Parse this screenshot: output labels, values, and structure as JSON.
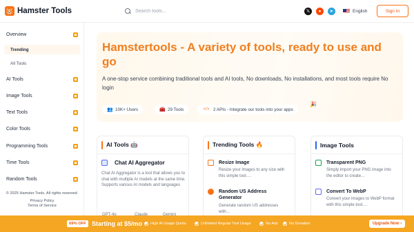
{
  "header": {
    "logo_glyph": "🐹",
    "logo_text": "Hamster Tools",
    "search_placeholder": "Search tools...",
    "language": "English",
    "signin_label": "Sign In",
    "social": [
      {
        "icon": "x-twitter-icon",
        "glyph": "𝕏",
        "color": "#111111"
      },
      {
        "icon": "reddit-icon",
        "glyph": "●",
        "color": "#ff4500"
      },
      {
        "icon": "telegram-icon",
        "glyph": "➤",
        "color": "#2aa3df"
      }
    ]
  },
  "sidebar": {
    "items": [
      {
        "label": "Overview"
      },
      {
        "label": "Trending"
      },
      {
        "label": "All Tools"
      },
      {
        "label": "AI Tools"
      },
      {
        "label": "Image Tools"
      },
      {
        "label": "Text Tools"
      },
      {
        "label": "Color Tools"
      },
      {
        "label": "Programming Tools"
      },
      {
        "label": "Time Tools"
      },
      {
        "label": "Random Tools"
      }
    ],
    "copyright": "© 2025 Hamster Tools. All rights reserved.",
    "privacy": "Privacy Policy",
    "terms": "Terms of Service"
  },
  "hero": {
    "title": "Hamstertools - A variety of tools, ready to use and go",
    "description": "A one-stop service combining traditional tools and AI tools, No downloads, No installations, and most tools require No login",
    "stats": [
      {
        "icon": "users-icon",
        "glyph": "👥",
        "label": "10K+ Users"
      },
      {
        "icon": "tools-icon",
        "glyph": "🧰",
        "label": "29 Tools"
      },
      {
        "icon": "code-icon",
        "glyph": "</>",
        "label": "2 APIs - Integrate our tools into your apps"
      }
    ],
    "party_glyph": "🎉"
  },
  "cards": {
    "ai": {
      "title": "AI Tools 🤖",
      "tool_name": "Chat AI Aggregator",
      "tool_desc": "Chat AI Aggregator is a tool that allows you to chat with multiple AI models at the same time. Supports various AI models and languages",
      "models": [
        "GPT-4o",
        "Claude",
        "Gemini"
      ]
    },
    "trending": {
      "title": "Trending Tools 🔥",
      "tools": [
        {
          "name": "Resize Image",
          "desc": "Resize your images to any size with this simple tool.…"
        },
        {
          "name": "Random US Address Generator",
          "desc": "Generate random US addresses with…"
        }
      ]
    },
    "image": {
      "title": "Image Tools",
      "tools": [
        {
          "name": "Transparent PNG",
          "desc": "Simply import your PNG image into the editor to create…"
        },
        {
          "name": "Convert To WebP",
          "desc": "Convert your images to WebP format with this simple tool.…"
        }
      ]
    }
  },
  "banner": {
    "off_badge": "69% OFF",
    "start_at": "Starting at $5/mo",
    "features": [
      "High AI Usage Quota",
      "Unlimited Regular Tool Usage",
      "No Ads",
      "No Donation"
    ],
    "upgrade_label": "Upgrade Now ›"
  },
  "colors": {
    "accent": "#f97316",
    "banner": "#f5a623",
    "hero_title": "#f07f1f"
  }
}
